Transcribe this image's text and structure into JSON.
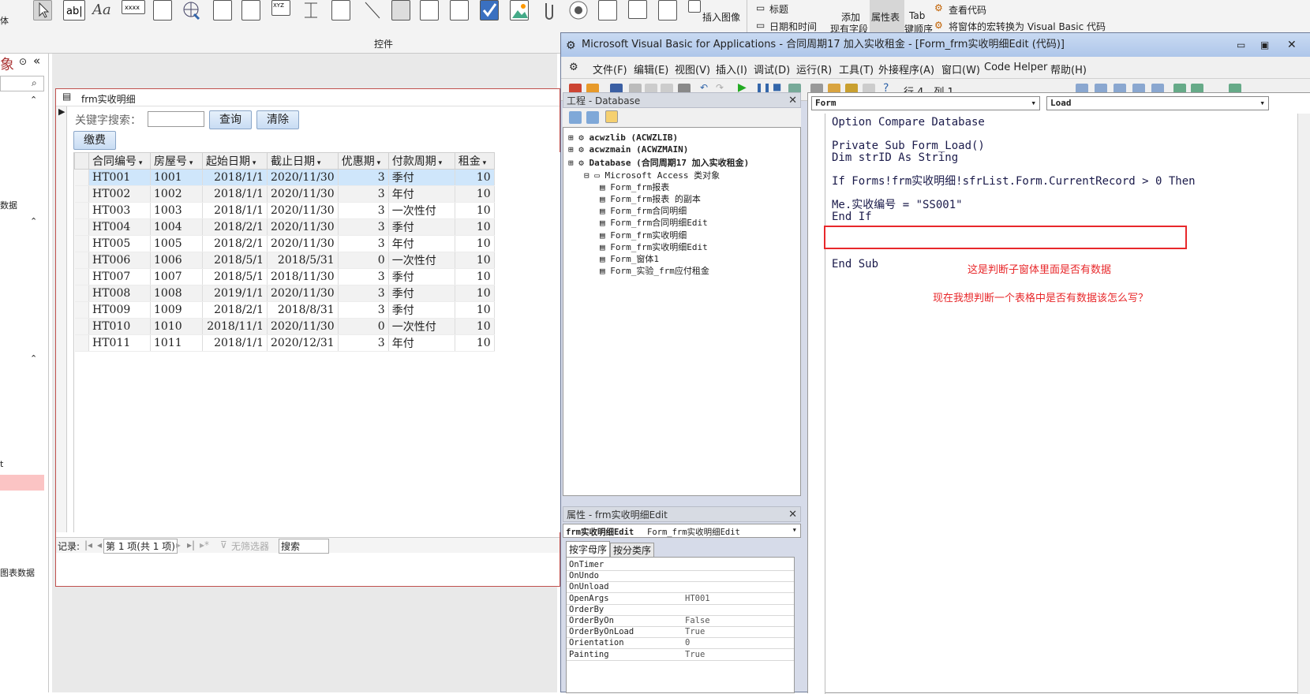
{
  "ribbon": {
    "group_label": "控件",
    "insert_image": "插入图像",
    "title_btn": "标题",
    "datetime_btn": "日期和时间",
    "add_field": "添加",
    "existing_field": "现有字段",
    "property_sheet": "属性表",
    "tab_label": "Tab",
    "tab_order": "键顺序",
    "view_code": "查看代码",
    "convert_macro": "将窗体的宏转换为 Visual Basic 代码"
  },
  "nav": {
    "title_char": "象",
    "side_labels": [
      "数据",
      "t",
      "图表数据"
    ],
    "left_edge_text": "体"
  },
  "access_form": {
    "title": "frm实收明细",
    "search_label": "关键字搜索：",
    "search_value": "",
    "query_button": "查询",
    "clear_button": "清除",
    "pay_button": "缴费",
    "columns": [
      "合同编号",
      "房屋号",
      "起始日期",
      "截止日期",
      "优惠期",
      "付款周期",
      "租金"
    ],
    "rows": [
      [
        "HT001",
        "1001",
        "2018/1/1",
        "2020/11/30",
        "3",
        "季付",
        "10"
      ],
      [
        "HT002",
        "1002",
        "2018/1/1",
        "2020/11/30",
        "3",
        "年付",
        "10"
      ],
      [
        "HT003",
        "1003",
        "2018/1/1",
        "2020/11/30",
        "3",
        "一次性付",
        "10"
      ],
      [
        "HT004",
        "1004",
        "2018/2/1",
        "2020/11/30",
        "3",
        "季付",
        "10"
      ],
      [
        "HT005",
        "1005",
        "2018/2/1",
        "2020/11/30",
        "3",
        "年付",
        "10"
      ],
      [
        "HT006",
        "1006",
        "2018/5/1",
        "2018/5/31",
        "0",
        "一次性付",
        "10"
      ],
      [
        "HT007",
        "1007",
        "2018/5/1",
        "2018/11/30",
        "3",
        "季付",
        "10"
      ],
      [
        "HT008",
        "1008",
        "2019/1/1",
        "2020/11/30",
        "3",
        "季付",
        "10"
      ],
      [
        "HT009",
        "1009",
        "2018/2/1",
        "2018/8/31",
        "3",
        "季付",
        "10"
      ],
      [
        "HT010",
        "1010",
        "2018/11/1",
        "2020/11/30",
        "0",
        "一次性付",
        "10"
      ],
      [
        "HT011",
        "1011",
        "2018/1/1",
        "2020/12/31",
        "3",
        "年付",
        "10"
      ]
    ],
    "record_label": "记录:",
    "record_position": "第 1 项(共 1 项)",
    "no_filter": "无筛选器",
    "search_box": "搜索"
  },
  "vba": {
    "title": "Microsoft Visual Basic for Applications - 合同周期17 加入实收租金 - [Form_frm实收明细Edit (代码)]",
    "menus": [
      "文件(F)",
      "编辑(E)",
      "视图(V)",
      "插入(I)",
      "调试(D)",
      "运行(R)",
      "工具(T)",
      "外接程序(A)",
      "窗口(W)",
      "Code Helper",
      "帮助(H)"
    ],
    "cursor_pos": "行 4，列 1",
    "project_title": "工程 - Database",
    "tree": [
      {
        "label": "acwzlib (ACWZLIB)",
        "bold": true,
        "level": 0
      },
      {
        "label": "acwzmain (ACWZMAIN)",
        "bold": true,
        "level": 0
      },
      {
        "label": "Database (合同周期17 加入实收租金)",
        "bold": true,
        "level": 0
      },
      {
        "label": "Microsoft Access 类对象",
        "bold": false,
        "level": 1
      },
      {
        "label": "Form_frm报表",
        "bold": false,
        "level": 2
      },
      {
        "label": "Form_frm报表 的副本",
        "bold": false,
        "level": 2
      },
      {
        "label": "Form_frm合同明细",
        "bold": false,
        "level": 2
      },
      {
        "label": "Form_frm合同明细Edit",
        "bold": false,
        "level": 2
      },
      {
        "label": "Form_frm实收明细",
        "bold": false,
        "level": 2
      },
      {
        "label": "Form_frm实收明细Edit",
        "bold": false,
        "level": 2
      },
      {
        "label": "Form_窗体1",
        "bold": false,
        "level": 2
      },
      {
        "label": "Form_实验_frm应付租金",
        "bold": false,
        "level": 2
      }
    ],
    "props_title": "属性 - frm实收明细Edit",
    "props_object": "frm实收明细Edit",
    "props_object_type": "Form_frm实收明细Edit",
    "props_tabs": [
      "按字母序",
      "按分类序"
    ],
    "props": [
      [
        "OnTimer",
        ""
      ],
      [
        "OnUndo",
        ""
      ],
      [
        "OnUnload",
        ""
      ],
      [
        "OpenArgs",
        "HT001"
      ],
      [
        "OrderBy",
        ""
      ],
      [
        "OrderByOn",
        "False"
      ],
      [
        "OrderByOnLoad",
        "True"
      ],
      [
        "Orientation",
        "0"
      ],
      [
        "Painting",
        "True"
      ]
    ],
    "object_combo": "Form",
    "proc_combo": "Load",
    "code_lines": [
      "Option Compare Database",
      "",
      "Private Sub Form_Load()",
      "Dim strID As String",
      "",
      "If Forms!frm实收明细!sfrList.Form.CurrentRecord > 0 Then",
      "",
      "Me.实收编号 = \"SS001\"",
      "End If",
      "",
      "",
      "",
      "End Sub"
    ],
    "note1": "这是判断子窗体里面是否有数据",
    "note2": "现在我想判断一个表格中是否有数据该怎么写？",
    "highlight_color": "#e8282b"
  }
}
